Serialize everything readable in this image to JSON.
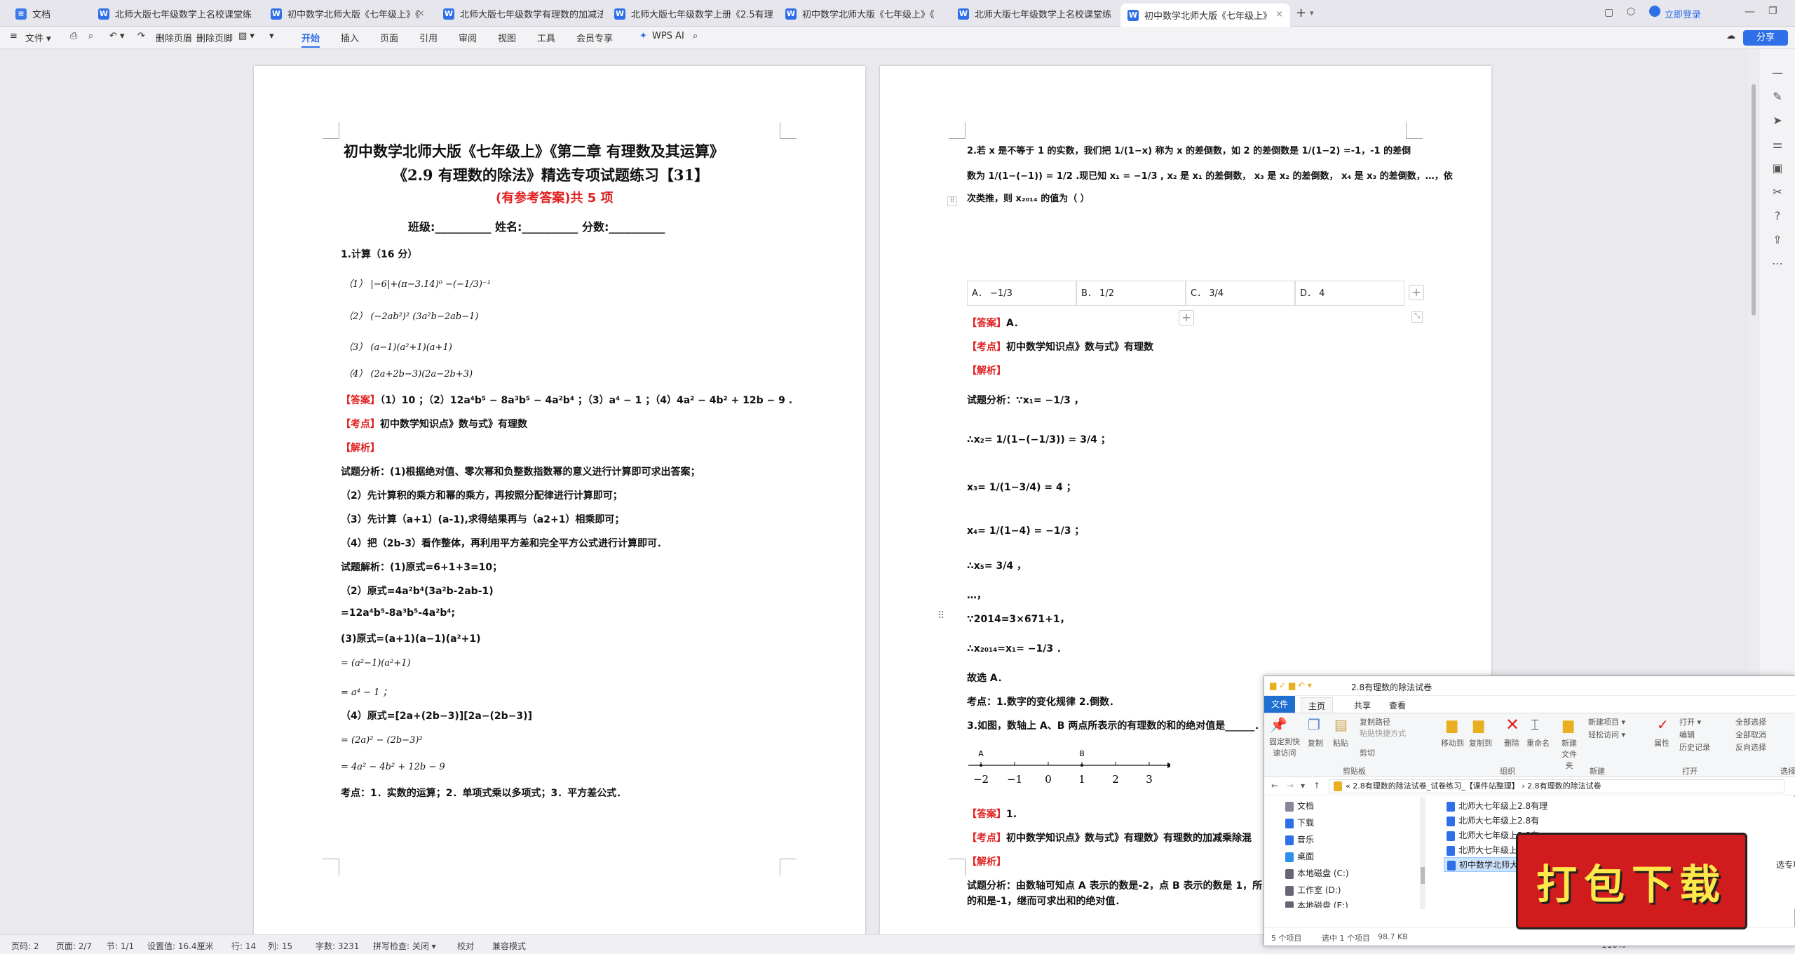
{
  "tabs": [
    {
      "label": "文档"
    },
    {
      "label": "北师大版七年级数学上名校课堂练"
    },
    {
      "label": "初中数学北师大版《七年级上》《"
    },
    {
      "label": "北师大版七年级数学有理数的加减法练习"
    },
    {
      "label": "北师大版七年级数学上册《2.5有理"
    },
    {
      "label": "初中数学北师大版《七年级上》《"
    },
    {
      "label": "北师大版七年级数学上名校课堂练"
    },
    {
      "label": "初中数学北师大版《七年级上》"
    }
  ],
  "window": {
    "login": "立即登录",
    "new_tab": "+"
  },
  "ribbon": {
    "file": "文件",
    "delete_page": "删除页眉",
    "delete_footer": "删除页脚",
    "tabs": [
      "开始",
      "插入",
      "页面",
      "引用",
      "审阅",
      "视图",
      "工具",
      "会员专享"
    ],
    "wps_ai": "WPS AI",
    "share": "分享"
  },
  "page1": {
    "title1": "初中数学北师大版《七年级上》《第二章 有理数及其运算》",
    "title2": "《2.9 有理数的除法》精选专项试题练习【31】",
    "subtitle": "(有参考答案)共 5 项",
    "fields": "班级:__________    姓名:__________    分数:__________",
    "q1": "1.计算（16 分）",
    "q1_1": "（1） |−6|+(π−3.14)⁰ −(−1/3)⁻¹",
    "q1_2": "（2） (−2ab²)² (3a²b−2ab−1)",
    "q1_3": "（3） (a−1)(a²+1)(a+1)",
    "q1_4": "（4） (2a+2b−3)(2a−2b+3)",
    "ans_label": "【答案】",
    "ans": "（1）10 ；（2）12a⁴b⁵ − 8a³b⁵ − 4a²b⁴ ；（3）a⁴ − 1 ；（4）4a² − 4b² + 12b − 9 .",
    "kp_label": "【考点】",
    "kp": "初中数学知识点》数与式》有理数",
    "jx_label": "【解析】",
    "l1": "试题分析：(1)根据绝对值、零次幂和负整数指数幂的意义进行计算即可求出答案；",
    "l2": "（2）先计算积的乘方和幂的乘方，再按照分配律进行计算即可；",
    "l3": "（3）先计算（a+1）(a-1),求得结果再与（a2+1）相乘即可；",
    "l4": "（4）把（2b-3）看作整体，再利用平方差和完全平方公式进行计算即可．",
    "l5": "试题解析：(1)原式=6+1+3=10；",
    "l6": "（2）原式=4a²b⁴(3a²b-2ab-1)",
    "l7": "=12a⁴b⁵-8a³b⁵-4a²b⁴;",
    "l8": "(3)原式=(a+1)(a−1)(a²+1)",
    "l9": "= (a²−1)(a²+1)",
    "l10": "= a⁴ − 1 ；",
    "l11": "（4）原式=[2a+(2b−3)][2a−(2b−3)]",
    "l12": "= (2a)² − (2b−3)²",
    "l13": "= 4a² − 4b² + 12b − 9",
    "l14": "考点：1．实数的运算；2．单项式乘以多项式；3．平方差公式．"
  },
  "page2": {
    "q2a": "2.若 x 是不等于 1 的实数，我们把 1/(1−x) 称为 x 的差倒数，如 2 的差倒数是 1/(1−2) =-1，-1 的差倒",
    "q2b": "数为 1/(1−(−1)) = 1/2 .现已知 x₁ = −1/3 , x₂ 是 x₁ 的差倒数， x₃ 是 x₂ 的差倒数， x₄ 是 x₃ 的差倒数，…，依",
    "q2c": "次类推，则 x₂₀₁₄ 的值为（    ）",
    "optA": "A． −1/3",
    "optB": "B． 1/2",
    "optC": "C． 3/4",
    "optD": "D． 4",
    "ans_label": "【答案】",
    "ans": "A．",
    "kp_label": "【考点】",
    "kp": "初中数学知识点》数与式》有理数",
    "jx_label": "【解析】",
    "s1": "试题分析：∵x₁= −1/3 ，",
    "s2": "∴x₂= 1/(1−(−1/3)) = 3/4 ；",
    "s3": "x₃= 1/(1−3/4) = 4 ；",
    "s4": "x₄= 1/(1−4) = −1/3 ；",
    "s5": "∴x₅= 3/4 ，",
    "s6": "…，",
    "s7": "∵2014=3×671+1，",
    "s8": "∴x₂₀₁₄=x₁= −1/3 ．",
    "s9": "故选 A．",
    "s10": "考点：1.数字的变化规律 2.倒数．",
    "q3": "3.如图，数轴上 A、B 两点所表示的有理数的和的绝对值是______．",
    "axis_labels": [
      "−2",
      "−1",
      "0",
      "1",
      "2",
      "3"
    ],
    "axis_points": [
      "A",
      "B"
    ],
    "ans3_label": "【答案】",
    "ans3": "1.",
    "kp3_label": "【考点】",
    "kp3": "初中数学知识点》数与式》有理数》有理数的加减乘除混",
    "jx3_label": "【解析】",
    "t1": "试题分析：由数轴可知点 A 表示的数是-2，点 B 表示的数是 1，所",
    "t2": "的和是-1，继而可求出和的绝对值．"
  },
  "status": {
    "page_num": "页码: 2",
    "page": "页面: 2/7",
    "section": "节: 1/1",
    "setting": "设置值: 16.4厘米",
    "row": "行: 14",
    "col": "列: 15",
    "words": "字数: 3231",
    "spell": "拼写检查: 关闭 ▾",
    "proof": "校对",
    "compat": "兼容模式",
    "zoom": "110%"
  },
  "explorer": {
    "title": "2.8有理数的除法试卷",
    "tabs": [
      "文件",
      "主页",
      "共享",
      "查看"
    ],
    "pin": "固定到快速访问",
    "copy": "复制",
    "paste": "粘贴",
    "copy_path": "复制路径",
    "paste_shortcut": "粘贴快捷方式",
    "cut": "剪切",
    "move_to": "移动到",
    "copy_to": "复制到",
    "delete": "删除",
    "rename": "重命名",
    "new_folder": "新建文件夹",
    "new_item": "新建项目 ▾",
    "easy_access": "轻松访问 ▾",
    "properties": "属性",
    "open": "打开 ▾",
    "edit": "编辑",
    "history": "历史记录",
    "select_all": "全部选择",
    "select_none": "全部取消",
    "invert": "反向选择",
    "groups": [
      "剪贴板",
      "组织",
      "新建",
      "打开",
      "选择"
    ],
    "path": "« 2.8有理数的除法试卷_试卷练习_【课件站整理】  ›  2.8有理数的除法试卷",
    "nav": [
      "文档",
      "下载",
      "音乐",
      "桌面",
      "本地磁盘 (C:)",
      "工作室 (D:)",
      "本地磁盘 (E:)"
    ],
    "files": [
      "北师大七年级上2.8有理",
      "北师大七年级上2.8有",
      "北师大七年级上2.8有",
      "北师大七年级上2.8有",
      "初中数学北师大版"
    ],
    "file_tail": "选专项",
    "count": "5 个项目",
    "selected": "选中 1 个项目",
    "size": "98.7 KB"
  },
  "banner": "打包下载"
}
